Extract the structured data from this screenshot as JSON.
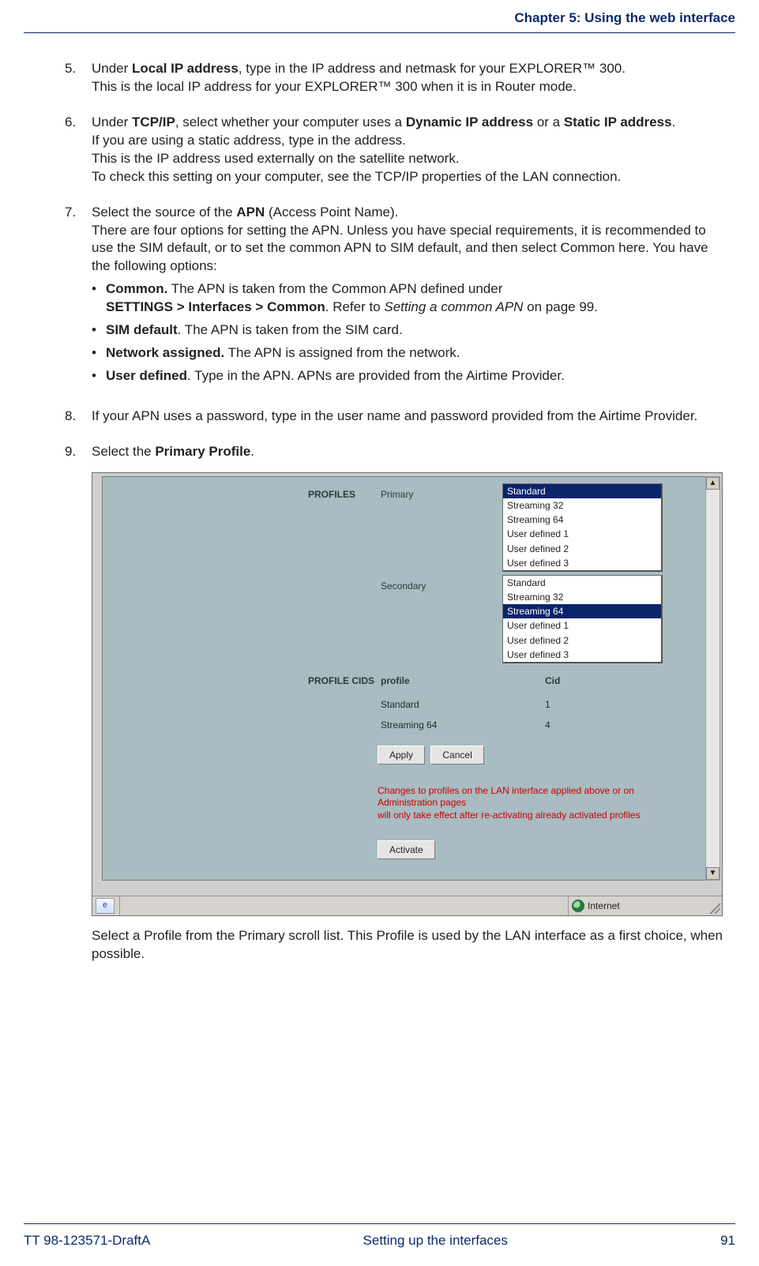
{
  "runningHead": "Chapter 5: Using the web interface",
  "steps": {
    "s5": {
      "num": "5.",
      "line1_pre": "Under ",
      "line1_b": "Local IP address",
      "line1_post": ", type in the IP address and netmask for your EXPLORER™ 300.",
      "line2": "This is the local IP address for your EXPLORER™ 300 when it is in Router mode."
    },
    "s6": {
      "num": "6.",
      "l1_pre": "Under ",
      "l1_b1": "TCP/IP",
      "l1_mid": ", select whether your computer uses a ",
      "l1_b2": "Dynamic IP address",
      "l1_mid2": " or a ",
      "l1_b3": "Static IP address",
      "l1_post": ".",
      "l2": "If you are using a static address, type in the address.",
      "l3": "This is the IP address used externally on the satellite network.",
      "l4": "To check this setting on your computer, see the TCP/IP properties of the LAN connection."
    },
    "s7": {
      "num": "7.",
      "l1_pre": "Select the source of the ",
      "l1_b": "APN",
      "l1_post": " (Access Point Name).",
      "l2": "There are four options for setting the APN. Unless you have special requirements, it is recommended to use the SIM default, or to set the common APN to SIM default, and then select Common here. You have the following options:",
      "bullets": {
        "b1_b": "Common.",
        "b1_t1": " The APN is taken from the Common APN defined under ",
        "b1_b2": "SETTINGS > Interfaces > Common",
        "b1_t2": ". Refer to ",
        "b1_i": "Setting a common APN",
        "b1_t3": " on page 99.",
        "b2_b": "SIM default",
        "b2_t": ". The APN is taken from the SIM card.",
        "b3_b": "Network assigned.",
        "b3_t": " The APN is assigned from the network.",
        "b4_b": "User defined",
        "b4_t": ". Type in the APN. APNs are provided from the Airtime Provider."
      }
    },
    "s8": {
      "num": "8.",
      "text": "If your APN uses a password, type in the user name and password provided from the Airtime Provider."
    },
    "s9": {
      "num": "9.",
      "pre": "Select the ",
      "b": "Primary Profile",
      "post": "."
    },
    "after_fig": "Select a Profile from the Primary scroll list. This Profile is used by the LAN interface as a first choice, when possible."
  },
  "figure": {
    "labels": {
      "profiles": "PROFILES",
      "primary": "Primary",
      "secondary": "Secondary",
      "profile_cids": "PROFILE CIDS",
      "profile": "profile",
      "cid": "Cid"
    },
    "primary_list": [
      "Standard",
      "Streaming 32",
      "Streaming 64",
      "User defined 1",
      "User defined 2",
      "User defined 3"
    ],
    "primary_selected": "Standard",
    "secondary_list": [
      "Standard",
      "Streaming 32",
      "Streaming 64",
      "User defined 1",
      "User defined 2",
      "User defined 3"
    ],
    "secondary_selected": "Streaming 64",
    "cids": [
      {
        "profile": "Standard",
        "cid": "1"
      },
      {
        "profile": "Streaming 64",
        "cid": "4"
      }
    ],
    "buttons": {
      "apply": "Apply",
      "cancel": "Cancel",
      "activate": "Activate"
    },
    "warning_l1": "Changes to profiles on the LAN interface applied above or on Administration pages",
    "warning_l2": "will only take effect after re-activating already activated profiles",
    "status": {
      "ie_glyph": "e",
      "zone": "Internet"
    },
    "scroll": {
      "up": "▲",
      "down": "▼"
    }
  },
  "footer": {
    "left": "TT 98-123571-DraftA",
    "center": "Setting up the interfaces",
    "right": "91"
  }
}
